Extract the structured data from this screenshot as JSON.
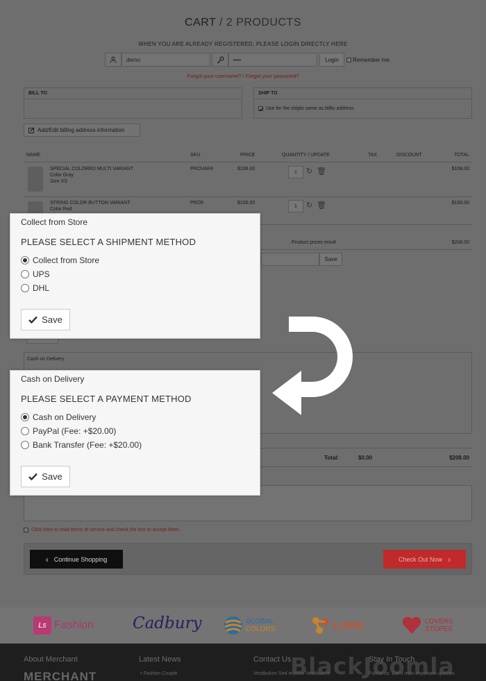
{
  "header": {
    "title": "CART",
    "separator": "/",
    "count": "2 PRODUCTS"
  },
  "login": {
    "hint": "WHEN YOU ARE ALREADY REGISTERED, PLEASE LOGIN DIRECTLY HERE",
    "username": "demo",
    "password": "••••",
    "login_label": "Login",
    "remember_label": "Remember me",
    "forgot_username": "Forgot your username?",
    "forgot_sep": "/",
    "forgot_password": "Forgot your password?"
  },
  "address": {
    "bill_to": "BILL TO",
    "ship_to": "SHIP TO",
    "ship_same": "Use for the shipto same as billto address",
    "edit_billing": "Add/Edit billing address information"
  },
  "table": {
    "headers": [
      "NAME",
      "SKU",
      "PRICE",
      "QUANTITY / UPDATE",
      "TAX",
      "DISCOUNT",
      "TOTAL"
    ],
    "rows": [
      {
        "name": "SPECIAL COLORED MULTI VARIANT",
        "attr1": "Color Gray",
        "attr2": "Size XS",
        "sku": "PROVAR4",
        "price": "$108.00",
        "qty": "1",
        "total": "$108.00"
      },
      {
        "name": "STRING COLOR BUTTON VARIANT",
        "attr1": "Color Red",
        "attr2": "",
        "sku": "PRO5",
        "price": "$100.00",
        "qty": "1",
        "total": "$100.00"
      }
    ],
    "product_prices_label": "Product prices result",
    "product_prices_value": "$208.00",
    "coupon_save": "Save"
  },
  "shipment_modal": {
    "title": "Collect from Store",
    "heading": "PLEASE SELECT A SHIPMENT METHOD",
    "options": [
      {
        "label": "Collect from Store",
        "selected": true
      },
      {
        "label": "UPS",
        "selected": false
      },
      {
        "label": "DHL",
        "selected": false
      }
    ],
    "save_label": "Save"
  },
  "payment_bg": {
    "label": "Cash on Delivery",
    "behind_save": "Save"
  },
  "payment_modal": {
    "title": "Cash on Delivery",
    "heading": "PLEASE SELECT A PAYMENT METHOD",
    "options": [
      {
        "label": "Cash on Delivery",
        "selected": true
      },
      {
        "label": "PayPal (Fee: +$20.00)",
        "selected": false
      },
      {
        "label": "Bank Transfer (Fee: +$20.00)",
        "selected": false
      }
    ],
    "save_label": "Save"
  },
  "totals": {
    "label": "Total:",
    "tax": "$0.00",
    "total": "$208.00"
  },
  "terms": "Click here to read terms of service and check the box to accept them.",
  "actions": {
    "continue": "Continue Shopping",
    "checkout": "Check Out Now"
  },
  "brands": [
    {
      "name": "Fashion",
      "badge": "Ls"
    },
    {
      "name": "Cadbury"
    },
    {
      "name": "GLOBAL",
      "name2": "COLORS"
    },
    {
      "name": "LOGO"
    },
    {
      "name": "LOVERS",
      "name2": "STOPEE"
    }
  ],
  "footer": {
    "col1": "About Merchant",
    "col1_big": "MERCHANT",
    "col2": "Latest News",
    "col2_item": "Fashion Couple",
    "col3": "Contact Us",
    "col3_item": "Vestibulum Sed et justo Vestibulum",
    "col4": "Stay In Touch",
    "col4_item": "Follow us. Don't miss important updates",
    "watermark": "BlackJoomla"
  },
  "colors": {
    "modal_bg": "#f6f6f6",
    "checkout": "#c02a2a",
    "continue": "#0f0f0f",
    "link_red": "#7a1818"
  }
}
